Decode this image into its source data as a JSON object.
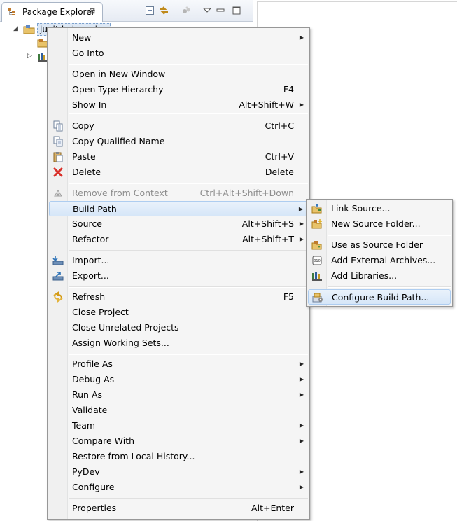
{
  "view": {
    "tab_label": "Package Explorer",
    "close_glyph": "⊠",
    "toolbar": [
      "collapse-all-icon",
      "link-with-editor-icon",
      "filter-icon",
      "view-menu-icon",
      "minimize-icon",
      "maximize-icon"
    ]
  },
  "tree": {
    "project_name": "junit-lydongxing",
    "twisty_open": "◢",
    "twisty_closed": "▷"
  },
  "context_menu": {
    "items": [
      {
        "label": "New",
        "shortcut": "",
        "submenu": true
      },
      {
        "label": "Go Into",
        "shortcut": "",
        "submenu": false
      },
      {
        "label": "Open in New Window",
        "shortcut": "",
        "submenu": false
      },
      {
        "label": "Open Type Hierarchy",
        "shortcut": "F4",
        "submenu": false
      },
      {
        "label": "Show In",
        "shortcut": "Alt+Shift+W",
        "submenu": true
      },
      {
        "label": "Copy",
        "shortcut": "Ctrl+C",
        "submenu": false,
        "icon": "copy-icon"
      },
      {
        "label": "Copy Qualified Name",
        "shortcut": "",
        "submenu": false,
        "icon": "copy-qualified-name-icon"
      },
      {
        "label": "Paste",
        "shortcut": "Ctrl+V",
        "submenu": false,
        "icon": "paste-icon"
      },
      {
        "label": "Delete",
        "shortcut": "Delete",
        "submenu": false,
        "icon": "delete-icon"
      },
      {
        "label": "Remove from Context",
        "shortcut": "Ctrl+Alt+Shift+Down",
        "submenu": false,
        "icon": "remove-context-icon",
        "disabled": true
      },
      {
        "label": "Build Path",
        "shortcut": "",
        "submenu": true,
        "highlighted": true
      },
      {
        "label": "Source",
        "shortcut": "Alt+Shift+S",
        "submenu": true
      },
      {
        "label": "Refactor",
        "shortcut": "Alt+Shift+T",
        "submenu": true
      },
      {
        "label": "Import...",
        "shortcut": "",
        "submenu": false,
        "icon": "import-icon"
      },
      {
        "label": "Export...",
        "shortcut": "",
        "submenu": false,
        "icon": "export-icon"
      },
      {
        "label": "Refresh",
        "shortcut": "F5",
        "submenu": false,
        "icon": "refresh-icon"
      },
      {
        "label": "Close Project",
        "shortcut": "",
        "submenu": false
      },
      {
        "label": "Close Unrelated Projects",
        "shortcut": "",
        "submenu": false
      },
      {
        "label": "Assign Working Sets...",
        "shortcut": "",
        "submenu": false
      },
      {
        "label": "Profile As",
        "shortcut": "",
        "submenu": true
      },
      {
        "label": "Debug As",
        "shortcut": "",
        "submenu": true
      },
      {
        "label": "Run As",
        "shortcut": "",
        "submenu": true
      },
      {
        "label": "Validate",
        "shortcut": "",
        "submenu": false
      },
      {
        "label": "Team",
        "shortcut": "",
        "submenu": true
      },
      {
        "label": "Compare With",
        "shortcut": "",
        "submenu": true
      },
      {
        "label": "Restore from Local History...",
        "shortcut": "",
        "submenu": false
      },
      {
        "label": "PyDev",
        "shortcut": "",
        "submenu": true
      },
      {
        "label": "Configure",
        "shortcut": "",
        "submenu": true
      },
      {
        "label": "Properties",
        "shortcut": "Alt+Enter",
        "submenu": false
      }
    ]
  },
  "build_path_menu": {
    "items": [
      {
        "label": "Link Source...",
        "icon": "link-source-icon"
      },
      {
        "label": "New Source Folder...",
        "icon": "new-source-folder-icon"
      },
      {
        "label": "Use as Source Folder",
        "icon": "use-as-source-folder-icon"
      },
      {
        "label": "Add External Archives...",
        "icon": "add-external-archives-icon"
      },
      {
        "label": "Add Libraries...",
        "icon": "add-libraries-icon"
      },
      {
        "label": "Configure Build Path...",
        "icon": "configure-build-path-icon",
        "highlighted": true
      }
    ]
  },
  "arrow_glyph": "▶",
  "colors": {
    "highlight": "#d6e6f8",
    "delete_red": "#d9302a",
    "menu_bg": "#f5f5f5"
  }
}
